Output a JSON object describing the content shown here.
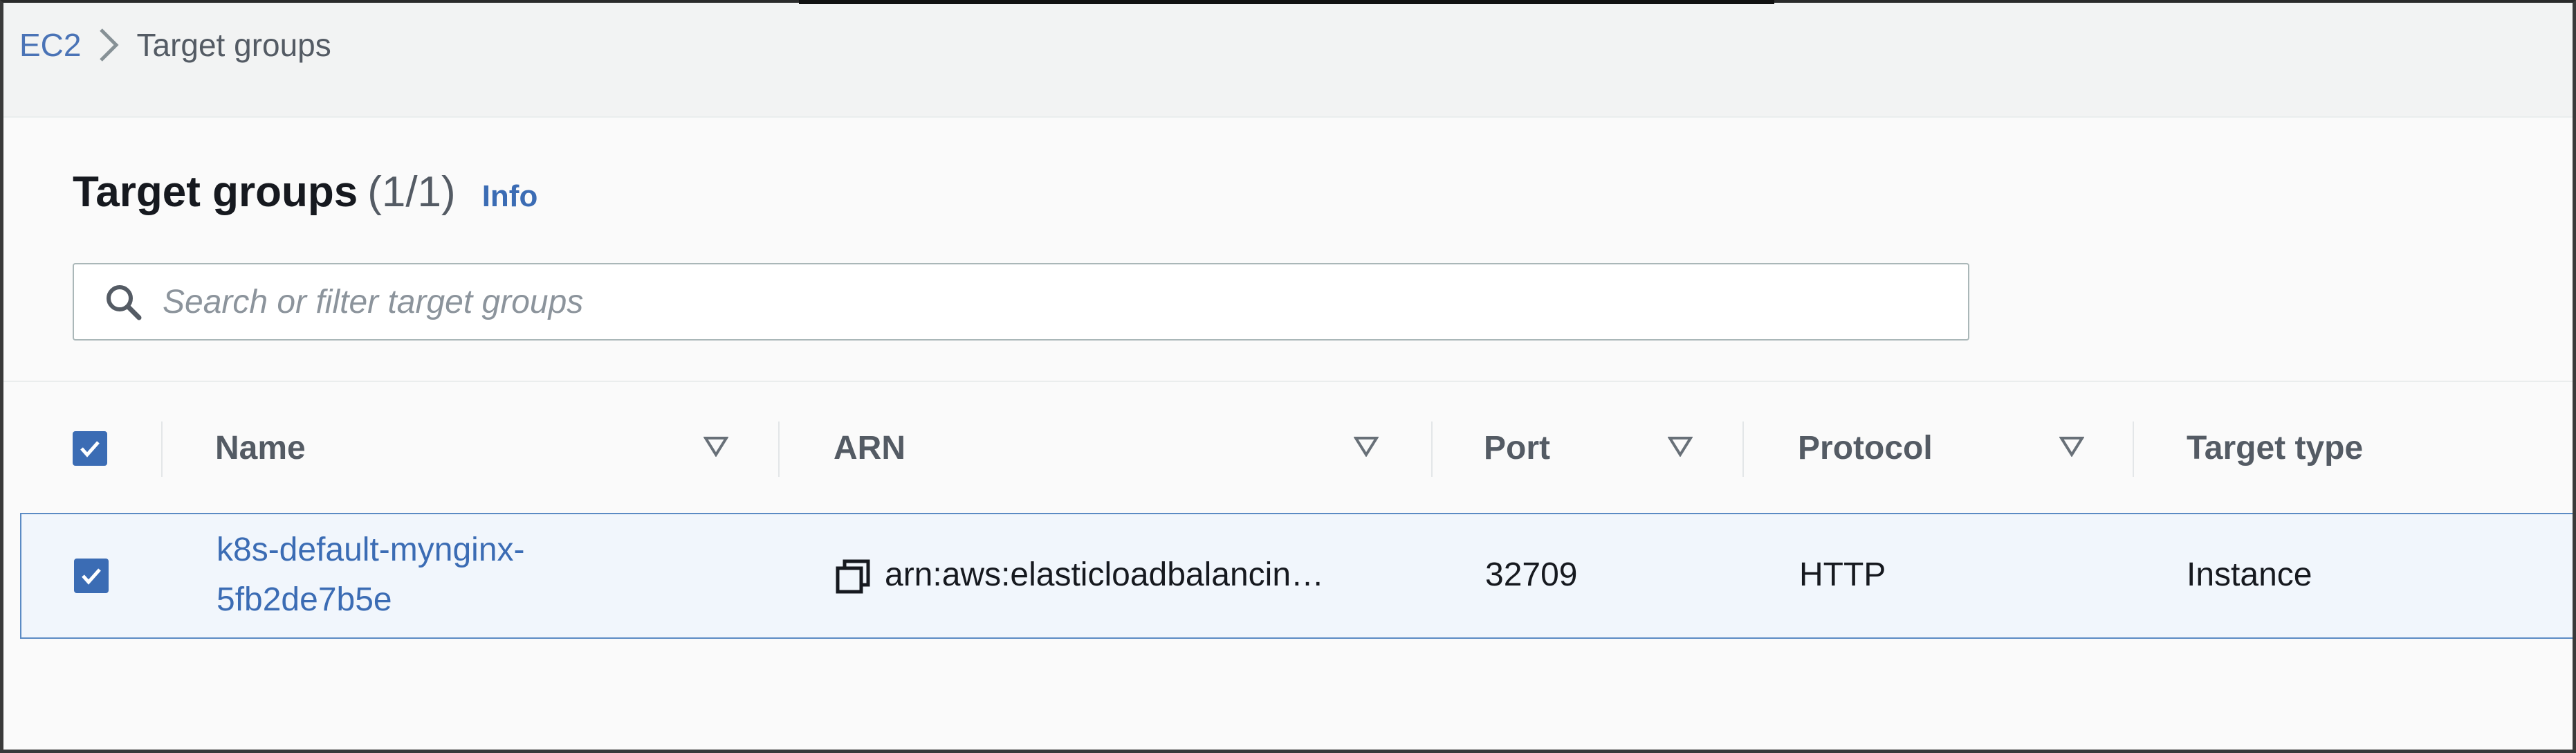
{
  "breadcrumb": {
    "root": "EC2",
    "current": "Target groups",
    "separator_icon": "chevron-right-icon"
  },
  "header": {
    "title": "Target groups",
    "count": "(1/1)",
    "info_link": "Info"
  },
  "search": {
    "placeholder": "Search or filter target groups",
    "value": "",
    "icon": "search-icon"
  },
  "table": {
    "columns": [
      {
        "label": "Name",
        "sortable": true
      },
      {
        "label": "ARN",
        "sortable": true
      },
      {
        "label": "Port",
        "sortable": true
      },
      {
        "label": "Protocol",
        "sortable": true
      },
      {
        "label": "Target type",
        "sortable": false
      }
    ],
    "select_all_checked": true,
    "rows": [
      {
        "selected": true,
        "name_line1": "k8s-default-mynginx-",
        "name_line2": "5fb2de7b5e",
        "arn": "arn:aws:elasticloadbalancin…",
        "port": "32709",
        "protocol": "HTTP",
        "target_type": "Instance"
      }
    ]
  },
  "colors": {
    "link": "#3b6cb4",
    "selected_row_bg": "#f1f6fc",
    "selected_row_border": "#5b8bc4",
    "checkbox": "#3b6cb4"
  }
}
